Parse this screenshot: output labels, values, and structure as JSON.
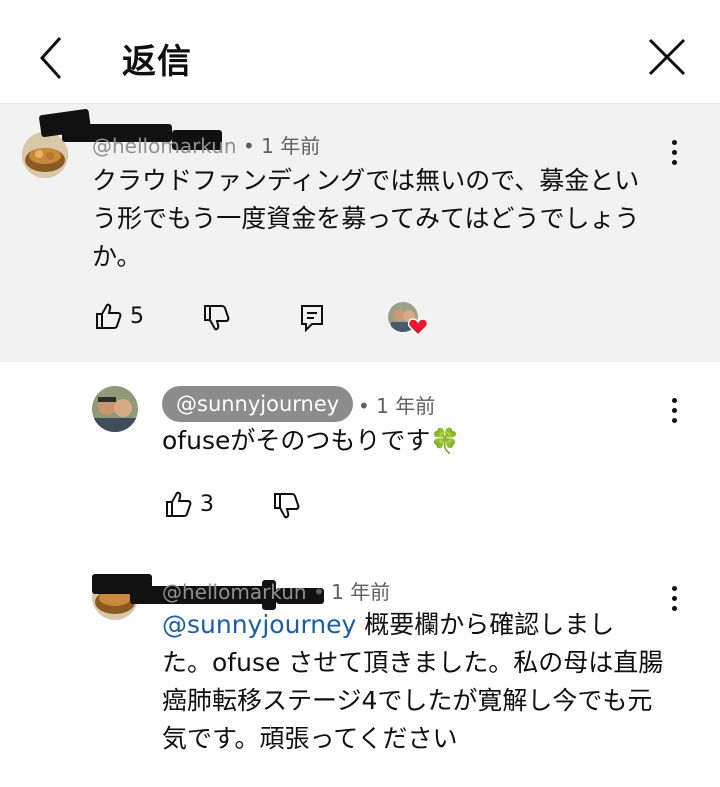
{
  "header": {
    "title": "返信"
  },
  "parent_comment": {
    "handle": "@hellomarkun",
    "time": "• 1 年前",
    "text_lines": [
      "クラウドファンディングでは無いので、募金とい",
      "う形でもう一度資金を募ってみてはどうでしょう",
      "か。"
    ],
    "like_count": "5"
  },
  "reply1": {
    "handle": "@sunnyjourney",
    "time": "• 1 年前",
    "text": "ofuseがそのつもりです",
    "emoji": "🍀",
    "like_count": "3"
  },
  "reply2": {
    "handle": "@hellomarkun",
    "time": "• 1 年前",
    "mention": "@sunnyjourney",
    "text_first": "  概要欄から確認しまし",
    "text_lines": [
      "た。ofuse させて頂きました。私の母は直腸",
      "癌肺転移ステージ4でしたが寛解し今でも元",
      "気です。頑張ってください"
    ]
  },
  "colors": {
    "parent_bg": "#f2f2f2",
    "mention": "#1a5ea8",
    "chip_bg": "#8c8c8c",
    "heart": "#e8172b"
  }
}
